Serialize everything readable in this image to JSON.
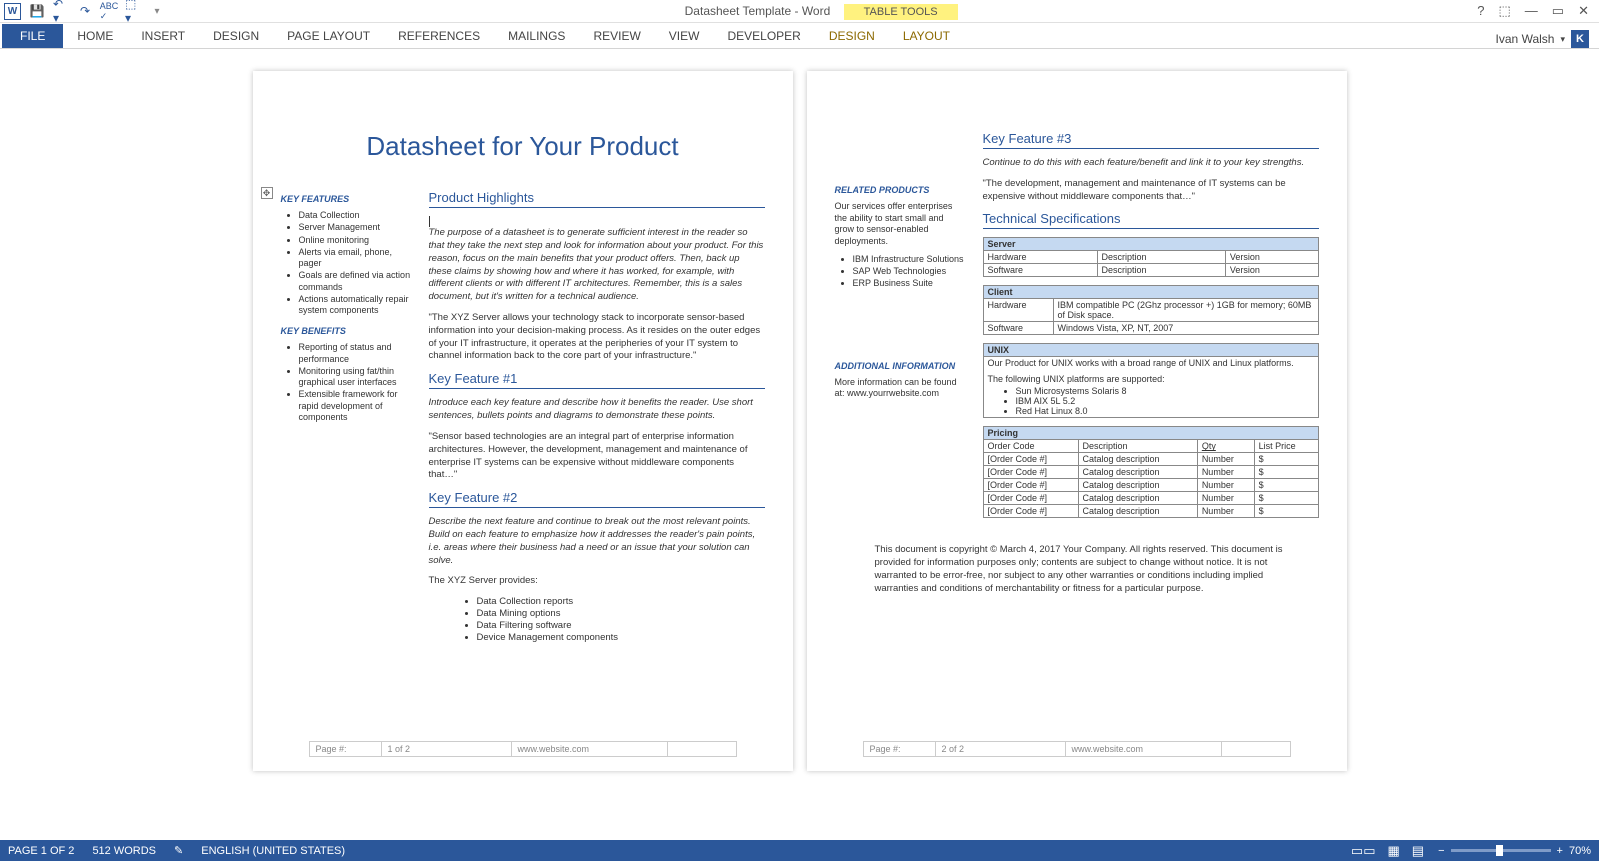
{
  "app": {
    "title": "Datasheet Template - Word",
    "table_tools": "TABLE TOOLS",
    "user_name": "Ivan Walsh",
    "user_initial": "K"
  },
  "ribbon": {
    "file": "FILE",
    "tabs": [
      "HOME",
      "INSERT",
      "DESIGN",
      "PAGE LAYOUT",
      "REFERENCES",
      "MAILINGS",
      "REVIEW",
      "VIEW",
      "DEVELOPER"
    ],
    "ctx_tabs": [
      "DESIGN",
      "LAYOUT"
    ]
  },
  "status": {
    "page": "PAGE 1 OF 2",
    "words": "512 WORDS",
    "lang": "ENGLISH (UNITED STATES)",
    "zoom": "70%"
  },
  "doc": {
    "title": "Datasheet for Your Product",
    "key_features_h": "KEY FEATURES",
    "key_features": [
      "Data Collection",
      "Server Management",
      "Online monitoring",
      "Alerts via email, phone, pager",
      "Goals are defined via action commands",
      "Actions automatically repair system components"
    ],
    "key_benefits_h": "KEY BENEFITS",
    "key_benefits": [
      "Reporting of status and performance",
      "Monitoring using fat/thin graphical user interfaces",
      "Extensible framework for rapid development of components"
    ],
    "ph_h": "Product Highlights",
    "ph_p1": "The purpose of a datasheet is to generate sufficient interest in the reader so that they take the next step and look for information about your product. For this reason, focus on the main benefits that your product offers. Then, back up these claims by showing how and where it has worked, for example, with different clients or with different IT architectures. Remember, this is a sales document, but it's written for a technical audience.",
    "ph_p2": "\"The XYZ Server allows your technology stack to incorporate sensor-based information into your decision-making process. As it resides on the outer edges of your IT infrastructure, it operates at the peripheries of your IT system to channel information back to the core part of your infrastructure.\"",
    "kf1_h": "Key Feature #1",
    "kf1_p1": "Introduce each key feature and describe how it benefits the reader. Use short sentences, bullets points and diagrams to demonstrate these points.",
    "kf1_p2": "\"Sensor based technologies are an integral part of enterprise information architectures. However, the development, management and maintenance of enterprise IT systems can be expensive without middleware components that…\"",
    "kf2_h": "Key Feature #2",
    "kf2_p1": "Describe the next feature and continue to break out the most relevant points. Build on each feature to emphasize how it addresses the reader's pain points, i.e. areas where their business had a need or an issue that your solution can solve.",
    "kf2_p2": "The XYZ Server provides:",
    "kf2_list": [
      "Data Collection reports",
      "Data Mining options",
      "Data Filtering software",
      "Device Management components"
    ],
    "footer1": {
      "label": "Page #:",
      "pn": "1 of 2",
      "site": "www.website.com"
    },
    "kf3_h": "Key Feature #3",
    "kf3_p1": "Continue to do this with each feature/benefit and link it to your key strengths.",
    "kf3_p2": "\"The development, management and maintenance of IT systems can be expensive without middleware components that…\"",
    "rp_h": "RELATED PRODUCTS",
    "rp_p": "Our services offer enterprises the ability to start small and grow to sensor-enabled deployments.",
    "rp_list": [
      "IBM Infrastructure Solutions",
      "SAP Web Technologies",
      "ERP Business Suite"
    ],
    "ai_h": "ADDITIONAL INFORMATION",
    "ai_p": "More information can be found at: www.yourrwebsite.com",
    "ts_h": "Technical Specifications",
    "server_tbl": {
      "header": "Server",
      "rows": [
        [
          "Hardware",
          "Description",
          "Version"
        ],
        [
          "Software",
          "Description",
          "Version"
        ]
      ]
    },
    "client_tbl": {
      "header": "Client",
      "rows": [
        [
          "Hardware",
          "IBM compatible PC (2Ghz processor +) 1GB for memory; 60MB of Disk space."
        ],
        [
          "Software",
          "Windows  Vista, XP, NT, 2007"
        ]
      ]
    },
    "unix_tbl": {
      "header": "UNIX",
      "p1": "Our Product for UNIX works with a broad range of UNIX and Linux platforms.",
      "p2": "The following UNIX platforms are supported:",
      "list": [
        "Sun Microsystems Solaris 8",
        "IBM AIX 5L 5.2",
        "Red Hat Linux 8.0"
      ]
    },
    "pricing_tbl": {
      "header": "Pricing",
      "cols": [
        "Order Code",
        "Description",
        "Qty",
        "List Price"
      ],
      "rows": [
        [
          "[Order Code #]",
          "Catalog description",
          "Number",
          "$"
        ],
        [
          "[Order Code #]",
          "Catalog description",
          "Number",
          "$"
        ],
        [
          "[Order Code #]",
          "Catalog description",
          "Number",
          "$"
        ],
        [
          "[Order Code #]",
          "Catalog description",
          "Number",
          "$"
        ],
        [
          "[Order Code #]",
          "Catalog description",
          "Number",
          "$"
        ]
      ]
    },
    "copyright": "This document is copyright © March 4, 2017 Your Company. All rights reserved. This document is provided for information purposes only; contents are subject to change without notice. It is not warranted to be error-free, nor subject to any other warranties or conditions including implied warranties and conditions of merchantability or fitness for a particular purpose.",
    "footer2": {
      "label": "Page #:",
      "pn": "2 of 2",
      "site": "www.website.com"
    }
  }
}
